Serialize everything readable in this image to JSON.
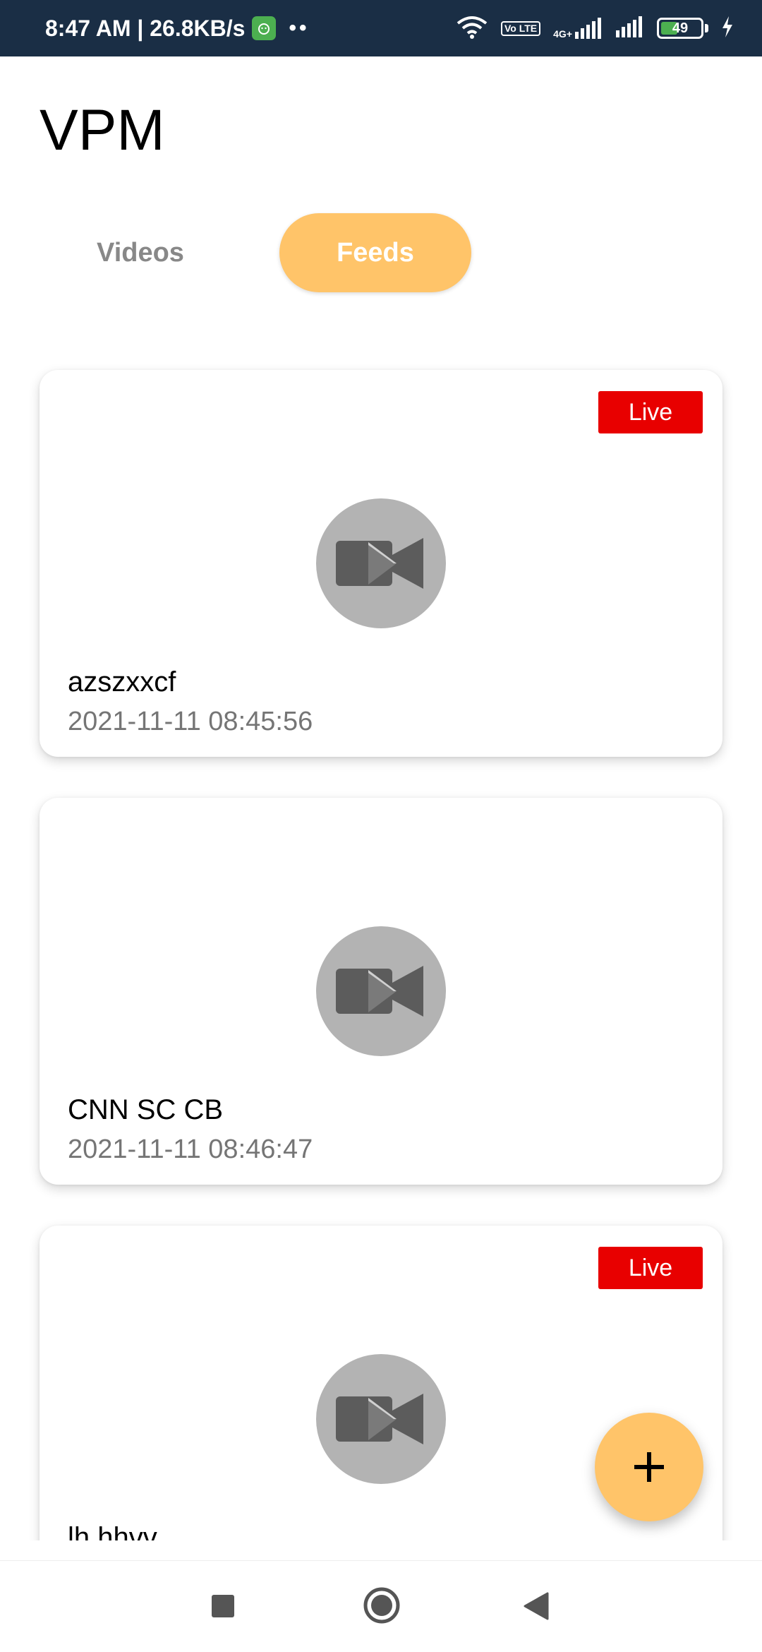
{
  "status_bar": {
    "time_speed": "8:47 AM | 26.8KB/s",
    "dots": "••",
    "volte_label": "Vo LTE",
    "network_type": "4G+",
    "battery": "49",
    "battery_level": 0.49,
    "icons": [
      "wifi-icon",
      "volte-icon",
      "signal-icon",
      "signal-icon",
      "battery-icon",
      "charging-icon"
    ]
  },
  "header": {
    "title": "VPM"
  },
  "tabs": [
    {
      "label": "Videos",
      "selected": false
    },
    {
      "label": "Feeds",
      "selected": true
    }
  ],
  "feeds": [
    {
      "title": "azszxxcf",
      "date": "2021-11-11 08:45:56",
      "live": true,
      "live_label": "Live"
    },
    {
      "title": "CNN SC CB",
      "date": "2021-11-11 08:46:47",
      "live": false,
      "live_label": ""
    },
    {
      "title": "lh hhvv",
      "date": "",
      "live": true,
      "live_label": "Live"
    }
  ],
  "fab": {
    "icon": "plus-icon"
  },
  "nav": {
    "icons": [
      "square-recents-icon",
      "circle-home-icon",
      "triangle-back-icon"
    ]
  },
  "colors": {
    "status_bar": "#1a2e45",
    "accent": "#ffc469",
    "live_badge": "#e80000",
    "placeholder_circle": "#b3b3b3",
    "placeholder_icon": "#5c5c5c"
  }
}
